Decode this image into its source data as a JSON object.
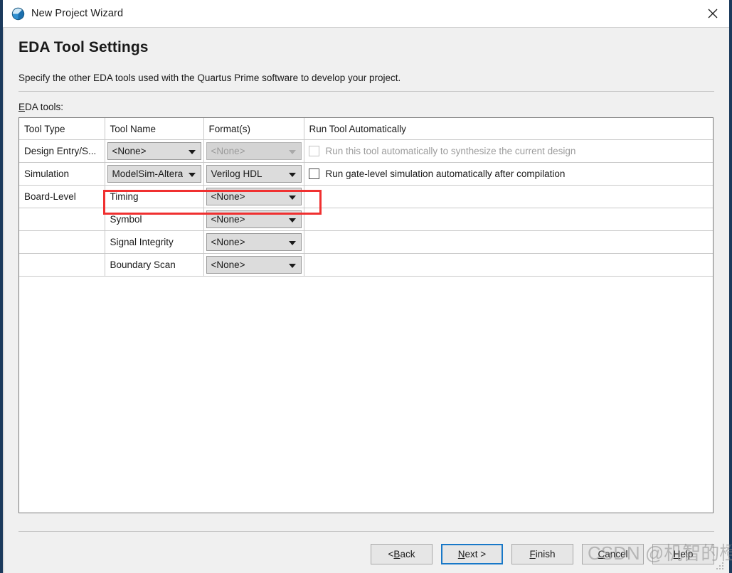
{
  "window": {
    "title": "New Project Wizard",
    "app_icon": "quartus-globe-icon",
    "close_icon": "close-icon"
  },
  "page": {
    "heading": "EDA Tool Settings",
    "subtitle": "Specify the other EDA tools used with the Quartus Prime software to develop your project.",
    "field_label_prefix": "E",
    "field_label_rest": "DA tools:"
  },
  "table": {
    "headers": [
      "Tool Type",
      "Tool Name",
      "Format(s)",
      "Run Tool Automatically"
    ],
    "rows": [
      {
        "tool_type": "Design Entry/S...",
        "tool_name": "<None>",
        "tool_name_disabled": false,
        "format": "<None>",
        "format_disabled": true,
        "run_label": "Run this tool automatically to synthesize the current design",
        "run_disabled": true,
        "run_checked": false
      },
      {
        "tool_type": "Simulation",
        "tool_name": "ModelSim-Altera",
        "tool_name_disabled": false,
        "format": "Verilog HDL",
        "format_disabled": false,
        "run_label": "Run gate-level simulation automatically after compilation",
        "run_disabled": false,
        "run_checked": false
      },
      {
        "tool_type": "Board-Level",
        "tool_name": "Timing",
        "is_plain_name": true,
        "format": "<None>",
        "format_disabled": false,
        "run_label": "",
        "run_disabled": true,
        "run_checked": false
      },
      {
        "tool_type": "",
        "tool_name": "Symbol",
        "is_plain_name": true,
        "format": "<None>",
        "format_disabled": false,
        "run_label": "",
        "run_disabled": true,
        "run_checked": false
      },
      {
        "tool_type": "",
        "tool_name": "Signal Integrity",
        "is_plain_name": true,
        "format": "<None>",
        "format_disabled": false,
        "run_label": "",
        "run_disabled": true,
        "run_checked": false
      },
      {
        "tool_type": "",
        "tool_name": "Boundary Scan",
        "is_plain_name": true,
        "format": "<None>",
        "format_disabled": false,
        "run_label": "",
        "run_disabled": true,
        "run_checked": false
      }
    ]
  },
  "annotation": {
    "type": "red-highlight-rectangle",
    "color": "#f03030",
    "targets": [
      "simulation-tool-name-combo",
      "simulation-format-combo"
    ]
  },
  "footer": {
    "buttons": [
      {
        "id": "back",
        "pre": "< ",
        "mnem": "B",
        "post": "ack",
        "focused": false
      },
      {
        "id": "next",
        "pre": "",
        "mnem": "N",
        "post": "ext >",
        "focused": true
      },
      {
        "id": "finish",
        "pre": "",
        "mnem": "F",
        "post": "inish",
        "focused": false
      },
      {
        "id": "cancel",
        "pre": "",
        "mnem": "C",
        "post": "ancel",
        "focused": false
      },
      {
        "id": "help",
        "pre": "",
        "mnem": "H",
        "post": "elp",
        "focused": false
      }
    ]
  },
  "watermark": {
    "text": "CSDN @机智的橙子"
  }
}
